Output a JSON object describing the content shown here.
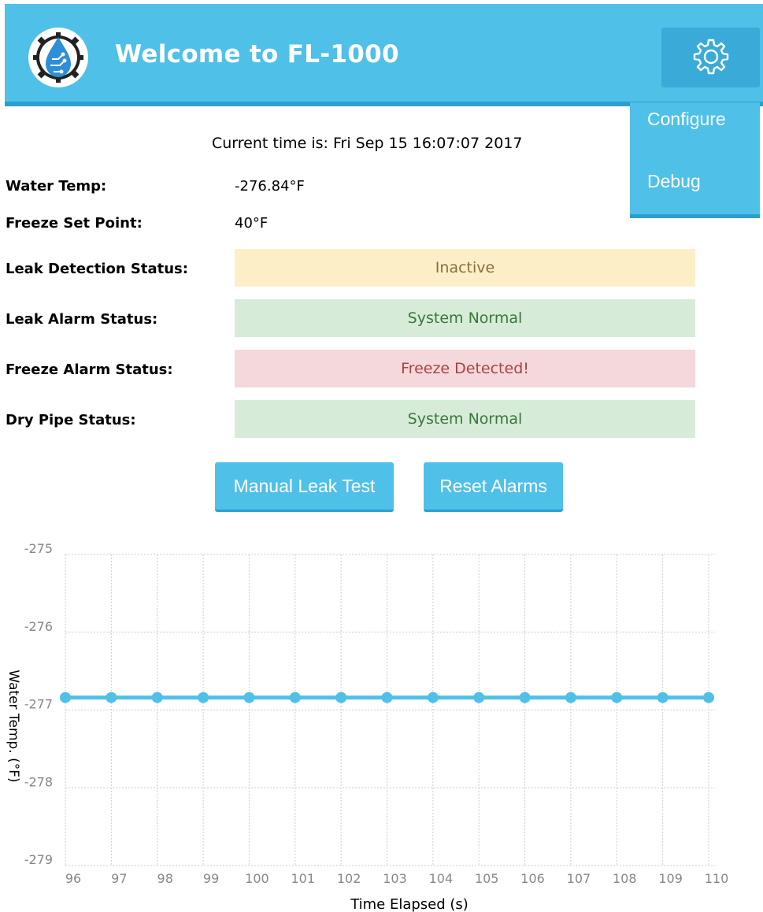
{
  "header": {
    "title": "Welcome to FL-1000",
    "logo_icon": "water-drop-circuit-gear-icon",
    "settings_icon": "gear-icon",
    "color": "#4fc0e8"
  },
  "menu": {
    "items": [
      {
        "label": "Configure"
      },
      {
        "label": "Debug"
      }
    ]
  },
  "current_time": "Current time is: Fri Sep 15 16:07:07 2017",
  "readings": {
    "water_temp_label": "Water Temp:",
    "water_temp_value": "-276.84°F",
    "freeze_set_point_label": "Freeze Set Point:",
    "freeze_set_point_value": "40°F"
  },
  "statuses": [
    {
      "label": "Leak Detection Status:",
      "value": "Inactive",
      "bg": "#fcefc8",
      "fg": "#8a6d3b"
    },
    {
      "label": "Leak Alarm Status:",
      "value": "System Normal",
      "bg": "#d6ecd8",
      "fg": "#3c763d"
    },
    {
      "label": "Freeze Alarm Status:",
      "value": "Freeze Detected!",
      "bg": "#f5d8db",
      "fg": "#a94442"
    },
    {
      "label": "Dry Pipe Status:",
      "value": "System Normal",
      "bg": "#d6ecd8",
      "fg": "#3c763d"
    }
  ],
  "buttons": {
    "manual_leak_test": "Manual Leak Test",
    "reset_alarms": "Reset Alarms"
  },
  "chart_data": {
    "type": "line",
    "xlabel": "Time Elapsed (s)",
    "ylabel": "Water Temp. (°F)",
    "x": [
      96,
      97,
      98,
      99,
      100,
      101,
      102,
      103,
      104,
      105,
      106,
      107,
      108,
      109,
      110
    ],
    "series": [
      {
        "values": [
          -276.84,
          -276.84,
          -276.84,
          -276.84,
          -276.84,
          -276.84,
          -276.84,
          -276.84,
          -276.84,
          -276.84,
          -276.84,
          -276.84,
          -276.84,
          -276.84,
          -276.84
        ]
      }
    ],
    "yticks": [
      -275,
      -276,
      -277,
      -278,
      -279
    ],
    "ylim": [
      -279,
      -275
    ],
    "xlim": [
      96,
      110
    ],
    "grid": true,
    "line_color": "#4fc0e8"
  }
}
